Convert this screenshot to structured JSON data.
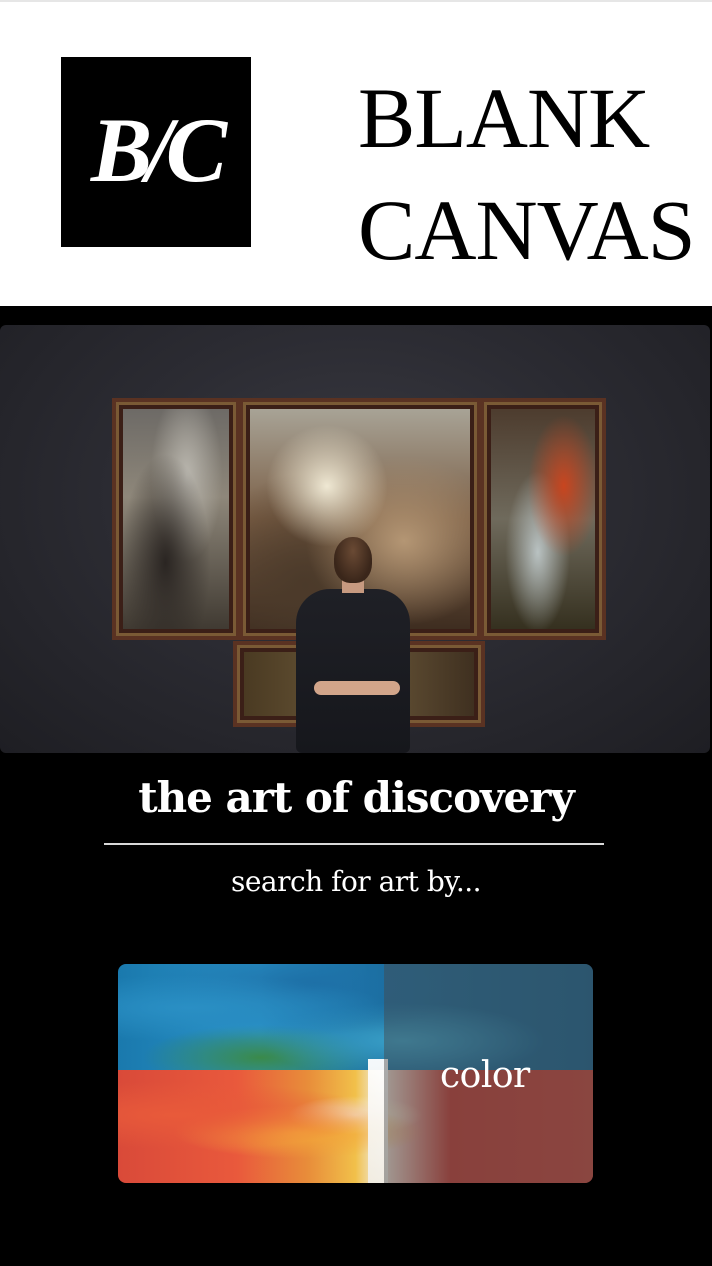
{
  "header": {
    "logo_text": "B/C",
    "brand_line1": "BLANK",
    "brand_line2": "CANVAS"
  },
  "hero": {
    "image_subject": "gallery visitor viewing triptych painting"
  },
  "main": {
    "tagline": "the art of discovery",
    "subtitle": "search for art by...",
    "search_options": [
      {
        "label": "color",
        "image": "abstract paint texture"
      }
    ]
  },
  "colors": {
    "page_background": "#000000",
    "header_background": "#ffffff",
    "logo_background": "#000000",
    "text_light": "#ffffff",
    "divider": "#d9d9d9"
  }
}
